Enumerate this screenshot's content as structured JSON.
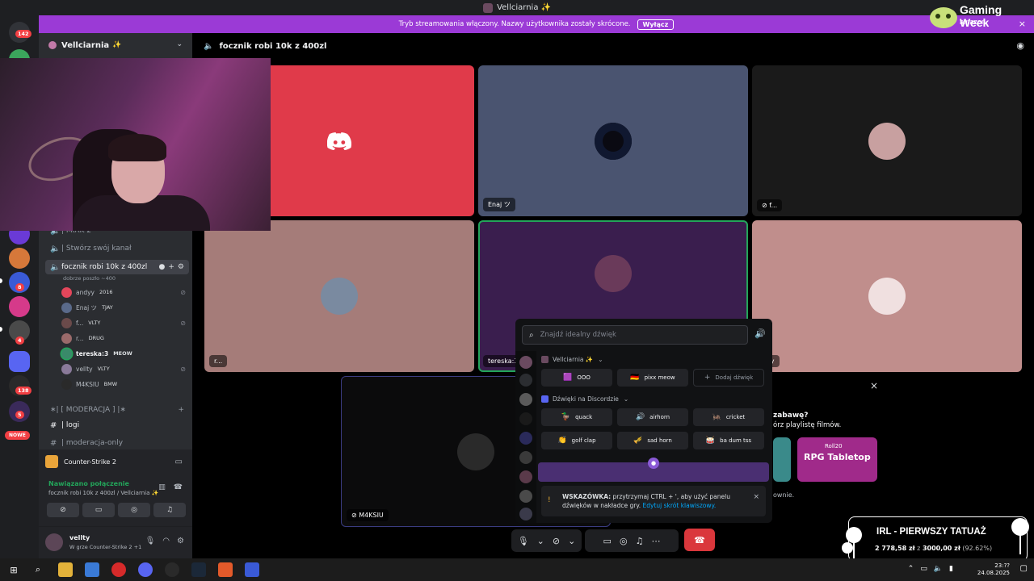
{
  "titlebar": {
    "title": "Vellciarnia",
    "star": "✨"
  },
  "banner": {
    "text": "Tryb streamowania włączony. Nazwy użytkownika zostały skrócone.",
    "button": "Wyłącz",
    "close": "×"
  },
  "rail": {
    "badge_top": "142",
    "badge_8": "8",
    "badge_4": "4",
    "badge_138": "138",
    "badge_5": "5",
    "nowe": "NOWE"
  },
  "sidebar": {
    "server_name": "Vellciarnia",
    "star": "✨",
    "channels": {
      "miak": "| MIAK 2",
      "create": "| Stwórz swój kanał",
      "voice_active": "focznik robi 10k z 400zl",
      "voice_sub": "dobrze poszło ~400",
      "moderacja_cat": "∗| [ MODERACJA ] |∗",
      "logi": "| logi",
      "moderacja_only": "| moderacja-only"
    },
    "members": [
      {
        "name": "andyy",
        "tag": "2016",
        "color": "#e3465b"
      },
      {
        "name": "Enaj ツ",
        "tag": "TJAY",
        "color": "#5a6a8a"
      },
      {
        "name": "f...",
        "tag": "VLTY",
        "color": "#6a4a4a"
      },
      {
        "name": "r...",
        "tag": "DRUG",
        "color": "#9a6a6a"
      },
      {
        "name": "tereska:3",
        "tag": "MEOW",
        "color": "#3a8a6a"
      },
      {
        "name": "vellty",
        "tag": "VLTY",
        "color": "#8a7a9a"
      },
      {
        "name": "M4KSIU",
        "tag": "BMW",
        "color": "#2a2a2a"
      }
    ],
    "activity": {
      "game": "Counter-Strike 2"
    },
    "voice": {
      "status": "Nawiązano połączenie",
      "channel": "focznik robi 10k z 400zl / Vellciarnia ✨"
    },
    "user": {
      "name": "vellty",
      "status": "W grze Counter-Strike 2 +1"
    }
  },
  "main": {
    "channel_title": "focznik robi 10k z 400zl",
    "tiles": {
      "t2": "Enaj ツ",
      "t3": "f...",
      "t4": "r...",
      "t5": "tereska:3",
      "t6": "...ty",
      "t7": "M4KSIU"
    }
  },
  "soundboard": {
    "search_placeholder": "Znajdź idealny dźwięk",
    "server_section": "Vellciarnia ✨",
    "discord_section": "Dźwięki na Discordzie",
    "sounds": {
      "ooo": "OOO",
      "pixx": "pixx meow",
      "add": "Dodaj dźwięk",
      "quack": "quack",
      "airhorn": "airhorn",
      "cricket": "cricket",
      "golfclap": "golf clap",
      "sadhorn": "sad horn",
      "badumtss": "ba dum tss"
    },
    "tip_bold": "WSKAZÓWKA:",
    "tip_text": " przytrzymaj CTRL + ', aby użyć panelu dźwięków w nakładce gry. ",
    "tip_link": "Edytuj skrót klawiszowy."
  },
  "promo": {
    "line1": "zabawę?",
    "line2": "órz playlistę filmów.",
    "line3": "ownie.",
    "card_brand": "Roll20",
    "card_title": "RPG Tabletop"
  },
  "overlay": {
    "gaming_week": "Gaming Week",
    "amazon": "amazon",
    "goal_title": "IRL - PIERWSZY TATUAŻ",
    "goal_amount": "2 778,58 zł",
    "goal_of": " z ",
    "goal_target": "3000,00 zł",
    "goal_pct": " (92.62%)"
  },
  "taskbar": {
    "time": "23:??",
    "date": "24.08.2025"
  },
  "colors": {
    "accent": "#5865f2",
    "banner": "#9b3ad6",
    "hangup": "#da373c",
    "connected": "#23a55a"
  }
}
